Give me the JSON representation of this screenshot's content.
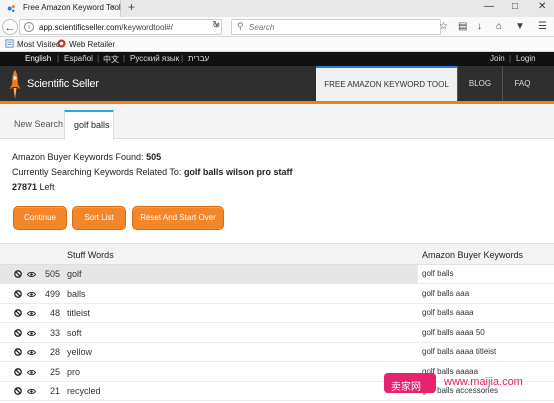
{
  "browser": {
    "tab_title": "Free Amazon Keyword Tool",
    "tab_close": "×",
    "new_tab": "+",
    "url_host": "app.scientificseller.com",
    "url_path": "/keywordtool#/",
    "search_placeholder": "Search",
    "bookmarks": [
      "Most Visited",
      "Web Retailer"
    ]
  },
  "site": {
    "languages": [
      "English",
      "Español",
      "中文",
      "Русский язык",
      "עברית"
    ],
    "account_links": [
      "Join",
      "Login"
    ],
    "brand": "Scientific Seller",
    "nav": [
      "FREE AMAZON KEYWORD TOOL",
      "BLOG",
      "FAQ"
    ],
    "accent_color": "#f47c20"
  },
  "tabs": [
    "New Search",
    "golf balls"
  ],
  "summary": {
    "found_label": "Amazon Buyer Keywords Found:",
    "found_value": "505",
    "searching_label": "Currently Searching Keywords Related To:",
    "searching_value": "golf balls wilson pro staff",
    "left_value": "27871",
    "left_label": "Left"
  },
  "buttons": [
    "Continue",
    "Sort List",
    "Reset And Start Over"
  ],
  "table": {
    "headers": [
      "Stuff Words",
      "Amazon Buyer Keywords"
    ],
    "rows": [
      {
        "count": "505",
        "word": "golf",
        "keyword": "golf balls"
      },
      {
        "count": "499",
        "word": "balls",
        "keyword": "golf balls aaa"
      },
      {
        "count": "48",
        "word": "titleist",
        "keyword": "golf balls aaaa"
      },
      {
        "count": "33",
        "word": "soft",
        "keyword": "golf balls aaaa 50"
      },
      {
        "count": "28",
        "word": "yellow",
        "keyword": "golf balls aaaa titleist"
      },
      {
        "count": "25",
        "word": "pro",
        "keyword": "golf balls aaaaa"
      },
      {
        "count": "21",
        "word": "recycled",
        "keyword": "golf balls accessories"
      }
    ]
  },
  "watermark": {
    "badge": "卖家网",
    "url": "www.maijia.com"
  }
}
